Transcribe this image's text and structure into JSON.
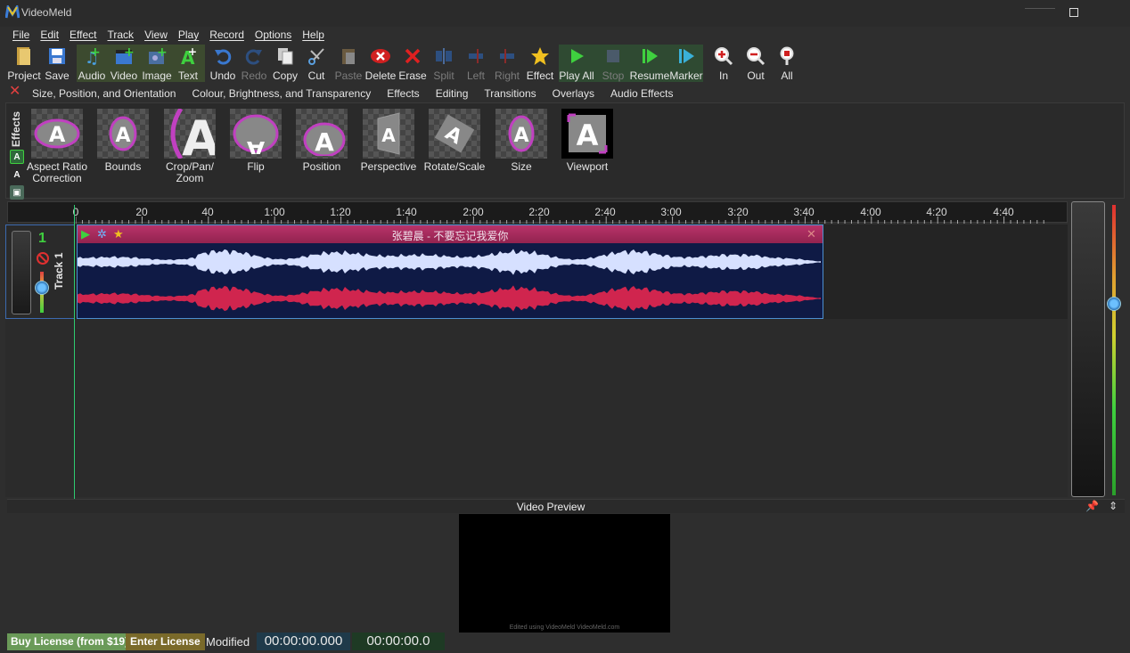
{
  "app": {
    "title": "VideoMeld"
  },
  "menu": [
    "File",
    "Edit",
    "Effect",
    "Track",
    "View",
    "Play",
    "Record",
    "Options",
    "Help"
  ],
  "toolbar": {
    "project": "Project",
    "save": "Save",
    "audio": "Audio",
    "video": "Video",
    "image": "Image",
    "text": "Text",
    "undo": "Undo",
    "redo": "Redo",
    "copy": "Copy",
    "cut": "Cut",
    "paste": "Paste",
    "delete": "Delete",
    "erase": "Erase",
    "split": "Split",
    "left": "Left",
    "right": "Right",
    "effect": "Effect",
    "play_all": "Play All",
    "stop": "Stop",
    "resume": "Resume",
    "marker": "Marker",
    "zoom_in": "In",
    "zoom_out": "Out",
    "zoom_all": "All"
  },
  "effect_tabs": [
    "Size, Position, and Orientation",
    "Colour, Brightness, and Transparency",
    "Effects",
    "Editing",
    "Transitions",
    "Overlays",
    "Audio Effects"
  ],
  "effects_panel": {
    "label": "Effects",
    "items": [
      "Aspect Ratio Correction",
      "Bounds",
      "Crop/Pan/ Zoom",
      "Flip",
      "Position",
      "Perspective",
      "Rotate/Scale",
      "Size",
      "Viewport"
    ]
  },
  "timeline": {
    "ruler_labels": [
      "0",
      "20",
      "40",
      "1:00",
      "1:20",
      "1:40",
      "2:00",
      "2:20",
      "2:40",
      "3:00",
      "3:20",
      "3:40",
      "4:00",
      "4:20",
      "4:40"
    ],
    "track": {
      "number": "1",
      "name": "Track 1"
    },
    "clip": {
      "title": "张碧晨 - 不要忘记我爱你"
    }
  },
  "preview": {
    "label": "Video Preview",
    "watermark": "Edited using VideoMeld   VideoMeld.com"
  },
  "status": {
    "buy_license": "Buy License (from $19)",
    "enter_license": "Enter License",
    "modified": "Modified",
    "timecode_1": "00:00:00.000",
    "timecode_2": "00:00:00.0"
  },
  "colors": {
    "clip_header": "#b8336a",
    "wave_top": "#d6e0ff",
    "wave_bottom": "#d0254e",
    "clip_bg": "#0f1a45",
    "playhead": "#2ecc71"
  }
}
